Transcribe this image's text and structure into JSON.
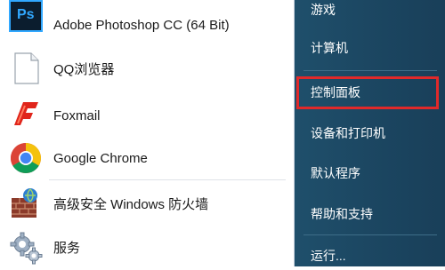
{
  "programs": [
    {
      "label": "Adobe Photoshop CC (64 Bit)",
      "icon": "photoshop-icon"
    },
    {
      "label": "QQ浏览器",
      "icon": "document-icon"
    },
    {
      "label": "Foxmail",
      "icon": "foxmail-icon"
    },
    {
      "label": "Google Chrome",
      "icon": "chrome-icon"
    },
    {
      "label": "高级安全 Windows 防火墙",
      "icon": "firewall-icon"
    },
    {
      "label": "服务",
      "icon": "services-gear-icon"
    }
  ],
  "photoshop_icon_text": "Ps",
  "right_menu": [
    {
      "label": "游戏"
    },
    {
      "label": "计算机"
    },
    {
      "label": "控制面板"
    },
    {
      "label": "设备和打印机"
    },
    {
      "label": "默认程序"
    },
    {
      "label": "帮助和支持"
    },
    {
      "label": "运行..."
    }
  ],
  "colors": {
    "accent_highlight": "#e0292a",
    "right_panel": "#1d4a65"
  }
}
